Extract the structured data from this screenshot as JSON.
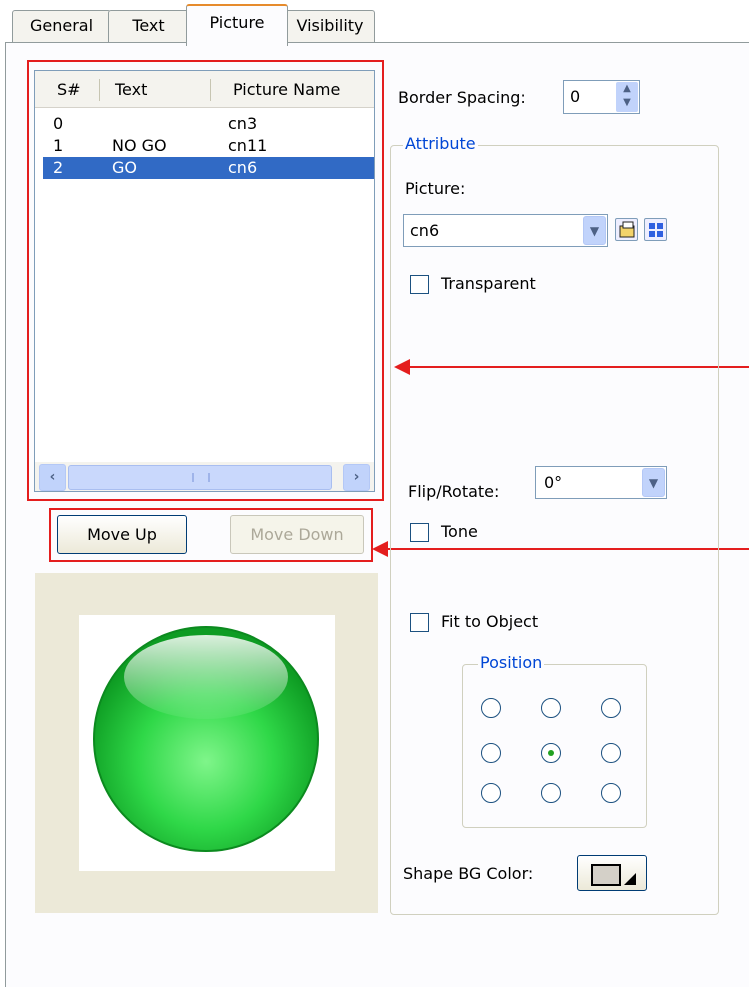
{
  "tabs": [
    "General",
    "Text",
    "Picture",
    "Visibility"
  ],
  "list": {
    "headers": [
      "S#",
      "Text",
      "Picture Name"
    ],
    "rows": [
      {
        "sn": "0",
        "text": "",
        "picture": "cn3"
      },
      {
        "sn": "1",
        "text": "NO GO",
        "picture": "cn11"
      },
      {
        "sn": "2",
        "text": "GO",
        "picture": "cn6"
      }
    ],
    "selected_row": 2,
    "scroll_left_glyph": "‹",
    "scroll_right_glyph": "›"
  },
  "buttons": {
    "move_up": "Move Up",
    "move_down": "Move Down"
  },
  "border_spacing": {
    "label": "Border Spacing:",
    "value": "0"
  },
  "attribute": {
    "title": "Attribute",
    "picture_label": "Picture:",
    "picture_value": "cn6",
    "transparent_label": "Transparent",
    "transparent_checked": false
  },
  "flip_rotate": {
    "label": "Flip/Rotate:",
    "value": "0°"
  },
  "tone": {
    "label": "Tone",
    "checked": false
  },
  "fit_to_object": {
    "label": "Fit to Object",
    "checked": false
  },
  "position": {
    "title": "Position",
    "selected_index": 4
  },
  "shape_bg": {
    "label": "Shape BG Color:"
  },
  "colors": {
    "selection": "#316ac5",
    "annotation": "#e41e1e",
    "preview_green": "#22c93a"
  },
  "icons": [
    "scroll-left-icon",
    "scroll-right-icon",
    "spin-up-icon",
    "spin-down-icon",
    "dropdown-arrow-icon",
    "open-folder-icon",
    "picture-library-icon",
    "green-button-picture",
    "color-swatch-icon"
  ]
}
